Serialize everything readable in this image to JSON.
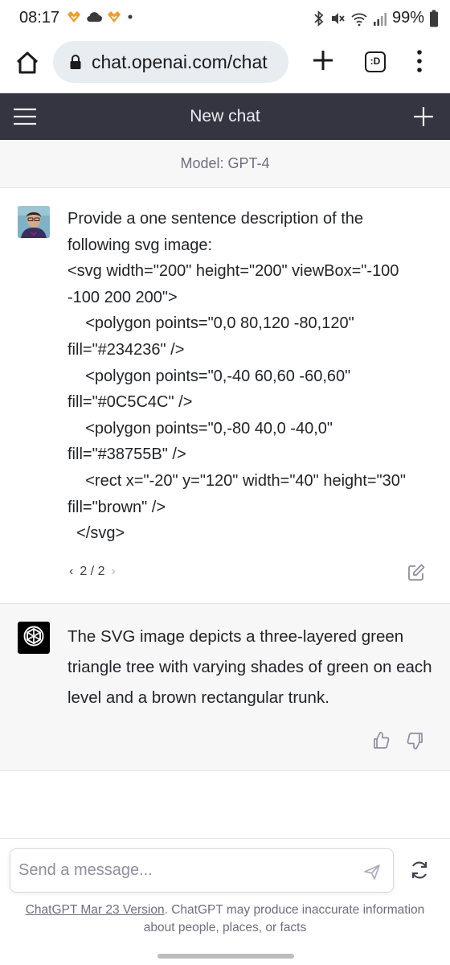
{
  "status_bar": {
    "time": "08:17",
    "battery": "99%"
  },
  "browser": {
    "url": "chat.openai.com/chat",
    "tab_count": ":D"
  },
  "header": {
    "title": "New chat"
  },
  "model_bar": {
    "label": "Model: GPT-4"
  },
  "user_message": {
    "lines": [
      "Provide a one sentence description of the",
      "following svg image:",
      "<svg width=\"200\" height=\"200\" viewBox=\"-100",
      "-100 200 200\">",
      "    <polygon points=\"0,0 80,120 -80,120\"",
      "fill=\"#234236\" />",
      "    <polygon points=\"0,-40 60,60 -60,60\"",
      "fill=\"#0C5C4C\" />",
      "    <polygon points=\"0,-80 40,0 -40,0\"",
      "fill=\"#38755B\" />",
      "    <rect x=\"-20\" y=\"120\" width=\"40\" height=\"30\"",
      "fill=\"brown\" />",
      "  </svg>"
    ],
    "pager": "2 / 2"
  },
  "assistant_message": {
    "text": "The SVG image depicts a three-layered green triangle tree with varying shades of green on each level and a brown rectangular trunk."
  },
  "composer": {
    "placeholder": "Send a message..."
  },
  "footer": {
    "version_link": "ChatGPT Mar 23 Version",
    "disclaimer": ". ChatGPT may produce inaccurate information about people, places, or facts"
  },
  "colors": {
    "header_bg": "#343541",
    "message_alt_bg": "#f7f7f8",
    "openai_logo_bg": "#000000"
  },
  "icons": [
    "home-icon",
    "lock-icon",
    "plus-icon",
    "tab-switcher-icon",
    "menu-kebab-icon",
    "hamburger-icon",
    "new-chat-icon",
    "edit-icon",
    "thumbs-up-icon",
    "thumbs-down-icon",
    "send-icon",
    "regenerate-icon",
    "openai-logo-icon"
  ]
}
